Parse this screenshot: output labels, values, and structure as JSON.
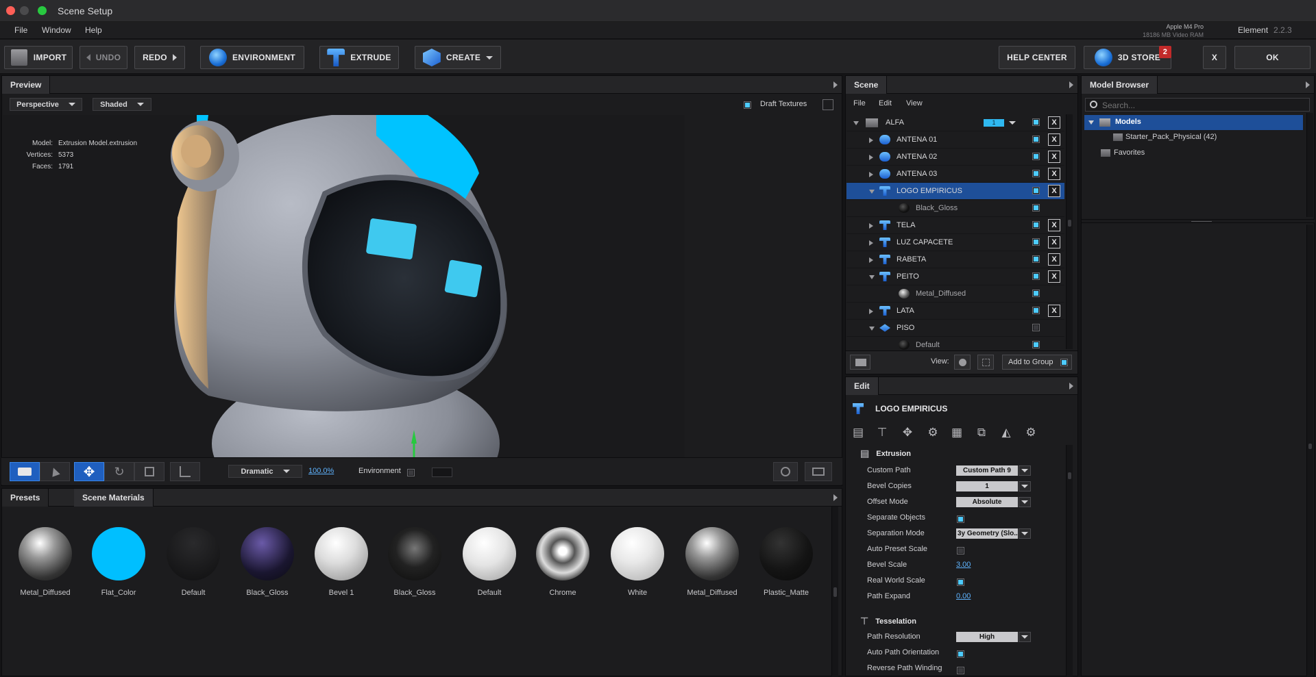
{
  "window": {
    "title": "Scene Setup"
  },
  "menu": [
    "File",
    "Window",
    "Help"
  ],
  "system": {
    "gpu": "Apple M4 Pro",
    "vram": "18186 MB Video RAM",
    "app": "Element",
    "version": "2.2.3"
  },
  "toolbar": {
    "import": "IMPORT",
    "undo": "UNDO",
    "redo": "REDO",
    "environment": "ENVIRONMENT",
    "extrude": "EXTRUDE",
    "create": "CREATE",
    "help_center": "HELP CENTER",
    "store": "3D STORE",
    "store_badge": "2",
    "close": "X",
    "ok": "OK"
  },
  "preview": {
    "tab": "Preview",
    "camera": "Perspective",
    "shading": "Shaded",
    "draft_textures": "Draft Textures",
    "model_label": "Model:",
    "model": "Extrusion Model.extrusion",
    "vertices_label": "Vertices:",
    "vertices": "5373",
    "faces_label": "Faces:",
    "faces": "1791",
    "lighting": "Dramatic",
    "zoom": "100.0%",
    "environment_label": "Environment"
  },
  "materials": {
    "tabs": [
      "Presets",
      "Scene Materials"
    ],
    "items": [
      {
        "name": "Metal_Diffused"
      },
      {
        "name": "Flat_Color",
        "color": "#00bfff"
      },
      {
        "name": "Default"
      },
      {
        "name": "Black_Gloss"
      },
      {
        "name": "Bevel 1"
      },
      {
        "name": "Black_Gloss"
      },
      {
        "name": "Default"
      },
      {
        "name": "Chrome"
      },
      {
        "name": "White"
      },
      {
        "name": "Metal_Diffused"
      },
      {
        "name": "Plastic_Matte"
      }
    ]
  },
  "scene": {
    "tab": "Scene",
    "menu": [
      "File",
      "Edit",
      "View"
    ],
    "group": {
      "name": "ALFA",
      "count": "1"
    },
    "rows": [
      {
        "name": "ANTENA 01",
        "icon": "pill",
        "x": true
      },
      {
        "name": "ANTENA 02",
        "icon": "pill",
        "x": true
      },
      {
        "name": "ANTENA 03",
        "icon": "pill",
        "x": true
      },
      {
        "name": "LOGO EMPIRICUS",
        "icon": "t",
        "x": true,
        "selected": true,
        "expanded": true
      },
      {
        "name": "Black_Gloss",
        "icon": "matdark",
        "x": false,
        "child": true
      },
      {
        "name": "TELA",
        "icon": "t",
        "x": true
      },
      {
        "name": "LUZ CAPACETE",
        "icon": "t",
        "x": true
      },
      {
        "name": "RABETA",
        "icon": "t",
        "x": true
      },
      {
        "name": "PEITO",
        "icon": "t",
        "x": true,
        "expanded": true
      },
      {
        "name": "Metal_Diffused",
        "icon": "mat",
        "x": false,
        "child": true
      },
      {
        "name": "LATA",
        "icon": "t",
        "x": true
      },
      {
        "name": "PISO",
        "icon": "plane",
        "x": false,
        "expanded": true
      },
      {
        "name": "Default",
        "icon": "matdark",
        "x": false,
        "child": true
      }
    ],
    "view_label": "View:",
    "add_to_group": "Add to Group"
  },
  "edit": {
    "tab": "Edit",
    "object": "LOGO EMPIRICUS",
    "extrusion": {
      "title": "Extrusion",
      "custom_path_label": "Custom Path",
      "custom_path": "Custom Path 9",
      "bevel_copies_label": "Bevel Copies",
      "bevel_copies": "1",
      "offset_mode_label": "Offset Mode",
      "offset_mode": "Absolute",
      "separate_objects_label": "Separate Objects",
      "separation_mode_label": "Separation Mode",
      "separation_mode": "3y Geometry (Slo...",
      "auto_preset_scale_label": "Auto Preset Scale",
      "bevel_scale_label": "Bevel Scale",
      "bevel_scale": "3.00",
      "real_world_scale_label": "Real World Scale",
      "path_expand_label": "Path Expand",
      "path_expand": "0.00"
    },
    "tesselation": {
      "title": "Tesselation",
      "path_resolution_label": "Path Resolution",
      "path_resolution": "High",
      "auto_path_orientation_label": "Auto Path Orientation",
      "reverse_path_winding_label": "Reverse Path Winding"
    }
  },
  "model_browser": {
    "tab": "Model Browser",
    "search_placeholder": "Search...",
    "tree": {
      "root": "Models",
      "child": "Starter_Pack_Physical (42)",
      "favorites": "Favorites"
    }
  },
  "colors": {
    "accent": "#4ecbff",
    "selection": "#1e4f99",
    "flat_color": "#00bfff"
  }
}
